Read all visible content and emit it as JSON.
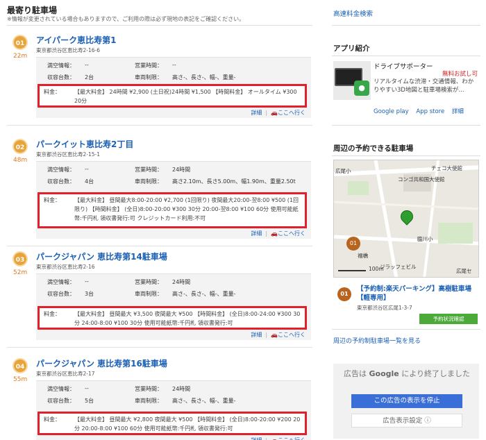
{
  "main": {
    "title": "最寄り駐車場",
    "notice": "※情報が変更されている場合もありますので、ご利用の際は必ず現地の表記をご確認ください。",
    "labels": {
      "availability": "満空情報：",
      "hours": "営業時間：",
      "capacity": "収容台数：",
      "restriction": "車両制限：",
      "fee": "料金：",
      "detail": "詳細",
      "goto": "ここへ行く"
    },
    "lots": [
      {
        "num": "01",
        "dist": "22m",
        "name": "アイパーク恵比寿第1",
        "addr": "東京都渋谷区恵比寿2-16-6",
        "availability": "--",
        "hours": "--",
        "capacity": "2台",
        "restriction": "高さ-、長さ-、幅-、重量-",
        "fee": "【最大料金】 24時間 ¥2,900 (土日祝)24時間 ¥1,500 【時間料金】 オールタイム ¥300 20分"
      },
      {
        "num": "02",
        "dist": "48m",
        "name": "パークイット恵比寿2丁目",
        "addr": "東京都渋谷区恵比寿2-15-1",
        "availability": "--",
        "hours": "24時間",
        "capacity": "4台",
        "restriction": "高さ2.10m、長さ5.00m、幅1.90m、重量2.50t",
        "fee": "【最大料金】 昼間最大8:00-20:00 ¥2,700 (1回限り) 夜間最大20:00-翌8:00 ¥500 (1回限り) 【時間料金】 (全日)8:00-20:00 ¥300 30分 20:00-翌8:00 ¥100 60分 使用可能紙幣:千円札 領収書発行:可 クレジットカード利用:不可"
      },
      {
        "num": "03",
        "dist": "52m",
        "name": "パークジャパン 恵比寿第14駐車場",
        "addr": "東京都渋谷区恵比寿2-16",
        "availability": "--",
        "hours": "24時間",
        "capacity": "3台",
        "restriction": "高さ-、長さ-、幅-、重量-",
        "fee": "【最大料金】 昼間最大 ¥3,500 夜間最大 ¥500 【時間料金】 (全日)8:00-24:00 ¥300 30分 24:00-8:00 ¥100 30分 使用可能紙幣:千円札 領収書発行:可"
      },
      {
        "num": "04",
        "dist": "55m",
        "name": "パークジャパン 恵比寿第16駐車場",
        "addr": "東京都渋谷区恵比寿2-17",
        "availability": "--",
        "hours": "24時間",
        "capacity": "5台",
        "restriction": "高さ-、長さ-、幅-、重量-",
        "fee": "【最大料金】 昼間最大 ¥2,800 夜間最大 ¥500 【時間料金】 (全日)8:00-20:00 ¥200 20分 20:00-8:00 ¥100 60分 使用可能紙幣:千円札 領収書発行:可"
      }
    ]
  },
  "side": {
    "highway_link": "高速料金検索",
    "app_heading": "アプリ紹介",
    "app_name": "ドライブサポーター",
    "app_free": "無料お試し可",
    "app_desc": "リアルタイムな渋滞・交通情報、わかりやすい3D地図と駐車場検索が...",
    "app_links": [
      "Google play",
      "App store",
      "詳細"
    ],
    "reserve_heading": "周辺の予約できる駐車場",
    "map_labels": [
      "チェコ大使館",
      "広尾小",
      "コンゴ共和国大使館",
      "臨川小",
      "ジラッフェビル",
      "広尾セ",
      "福橋",
      "100m",
      "01"
    ],
    "reserve_num": "01",
    "reserve_name": "【予約制:楽天パーキング】高樹駐車場【軽専用】",
    "reserve_addr": "東京都渋谷区広尾1-3-7",
    "reserve_btn": "予約状況確認",
    "reserve_list_link": "周辺の予約制駐車場一覧を見る",
    "ad_text1": "広告は",
    "ad_google": "Google",
    "ad_text2": "により終了しました",
    "ad_stop": "この広告の表示を停止",
    "ad_settings": "広告表示設定 ⓘ"
  },
  "colors": {
    "link": "#1a5fb4",
    "badge": "#e8a33a",
    "highlight": "#e0202a",
    "green": "#4caa3a",
    "ad_blue": "#3b6fd8"
  }
}
